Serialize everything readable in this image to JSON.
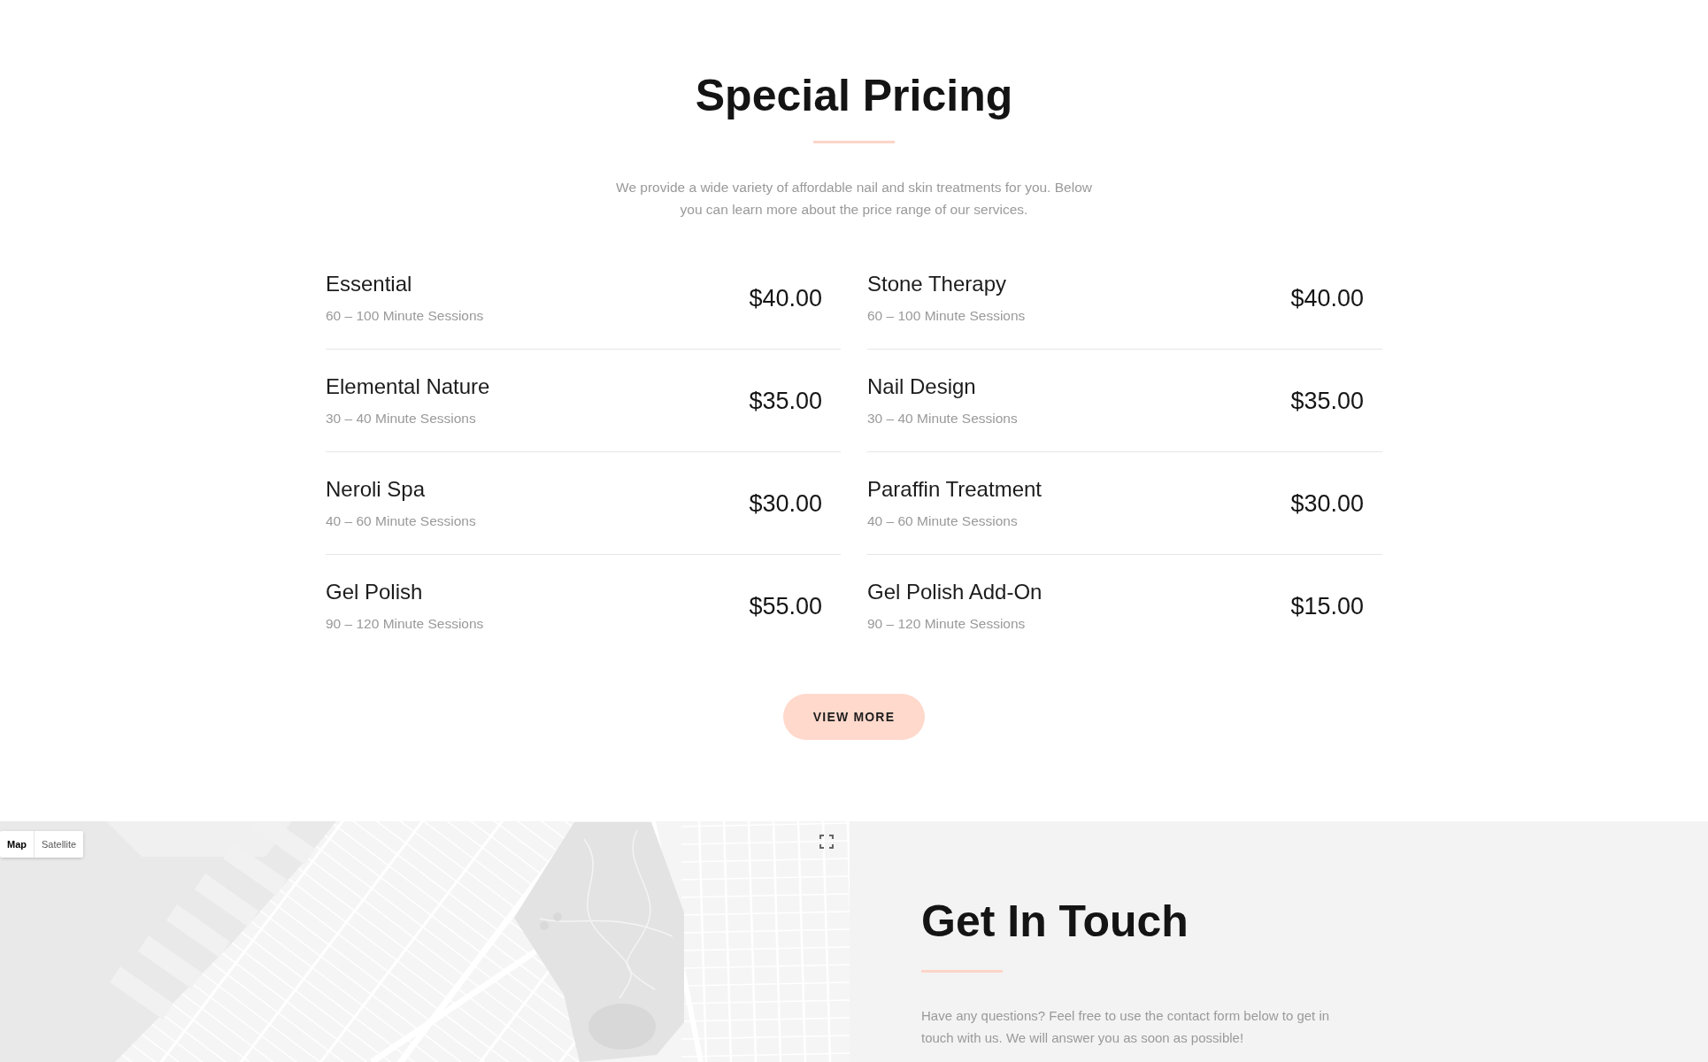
{
  "pricing": {
    "title": "Special Pricing",
    "intro": "We provide a wide variety of affordable nail and skin treatments for you. Below you can learn more about the price range of our services.",
    "columns": [
      {
        "items": [
          {
            "name": "Essential",
            "duration": "60 – 100 Minute Sessions",
            "price": "$40.00"
          },
          {
            "name": "Elemental Nature",
            "duration": "30 – 40 Minute Sessions",
            "price": "$35.00"
          },
          {
            "name": "Neroli Spa",
            "duration": "40 – 60 Minute Sessions",
            "price": "$30.00"
          },
          {
            "name": "Gel Polish",
            "duration": "90 – 120 Minute Sessions",
            "price": "$55.00"
          }
        ]
      },
      {
        "items": [
          {
            "name": "Stone Therapy",
            "duration": "60 – 100 Minute Sessions",
            "price": "$40.00"
          },
          {
            "name": "Nail Design",
            "duration": "30 – 40 Minute Sessions",
            "price": "$35.00"
          },
          {
            "name": "Paraffin Treatment",
            "duration": "40 – 60 Minute Sessions",
            "price": "$30.00"
          },
          {
            "name": "Gel Polish Add-On",
            "duration": "90 – 120 Minute Sessions",
            "price": "$15.00"
          }
        ]
      }
    ],
    "button": "VIEW MORE"
  },
  "map": {
    "map_types": [
      {
        "label": "Map",
        "selected": true
      },
      {
        "label": "Satellite",
        "selected": false
      }
    ]
  },
  "contact": {
    "title": "Get In Touch",
    "text": "Have any questions? Feel free to use the contact form below to get in touch with us. We will answer you as soon as possible!"
  }
}
